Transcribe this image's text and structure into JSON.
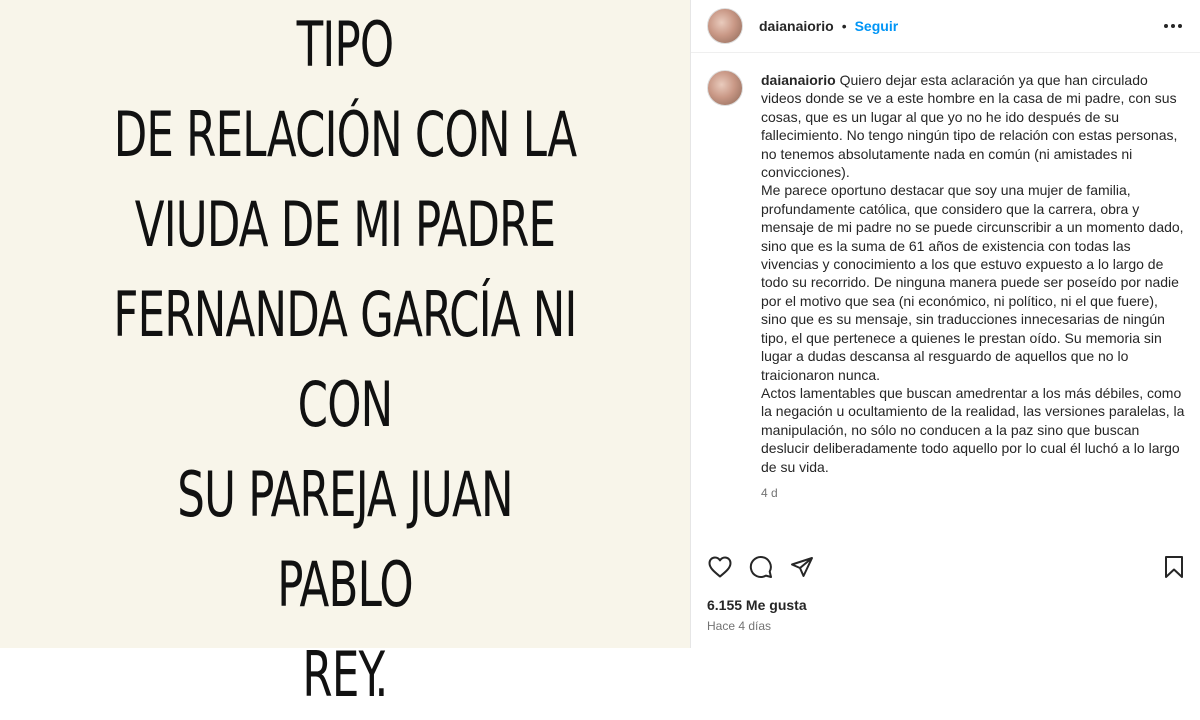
{
  "post_image": {
    "text": "NO TENGO NINGÚN TIPO\nDE RELACIÓN CON LA\nVIUDA DE MI PADRE\nFERNANDA GARCÍA NI CON\nSU PAREJA JUAN PABLO\nREY."
  },
  "header": {
    "username": "daianaiorio",
    "separator": "•",
    "follow_label": "Seguir",
    "more_icon": "more-horizontal-icon"
  },
  "caption": {
    "username": "daianaiorio",
    "text": "Quiero dejar esta aclaración ya que han circulado videos donde se ve a este hombre en la casa de mi padre, con sus cosas, que es un lugar al que yo no he ido después de su fallecimiento. No tengo ningún tipo de relación con estas personas, no tenemos absolutamente nada en común (ni amistades ni convicciones).\nMe parece oportuno destacar que soy una mujer de familia, profundamente católica, que considero que la carrera, obra y mensaje de mi padre no se puede circunscribir a un momento dado, sino que es la suma de 61 años de existencia con todas las vivencias y conocimiento a los que estuvo expuesto a lo largo de todo su recorrido. De ninguna manera puede ser poseído por nadie por el motivo que sea (ni económico, ni político, ni el que fuere), sino que es su mensaje, sin traducciones innecesarias de ningún tipo, el que pertenece a quienes le prestan oído. Su memoria sin lugar a dudas descansa al resguardo de aquellos que no lo traicionaron nunca.\nActos lamentables que buscan amedrentar a los más débiles, como la negación u ocultamiento de la realidad, las versiones paralelas, la manipulación, no sólo no conducen a la paz sino que buscan deslucir deliberadamente todo aquello por lo cual él luchó a lo largo de su vida.",
    "time": "4 d"
  },
  "actions": {
    "like_icon": "heart-icon",
    "comment_icon": "comment-icon",
    "share_icon": "send-icon",
    "save_icon": "bookmark-icon"
  },
  "likes_text": "6.155 Me gusta",
  "posted_ago": "Hace 4 días",
  "colors": {
    "image_background": "#f8f5ea",
    "accent_blue": "#0095f6",
    "text_primary": "#262626",
    "text_secondary": "#737373"
  }
}
